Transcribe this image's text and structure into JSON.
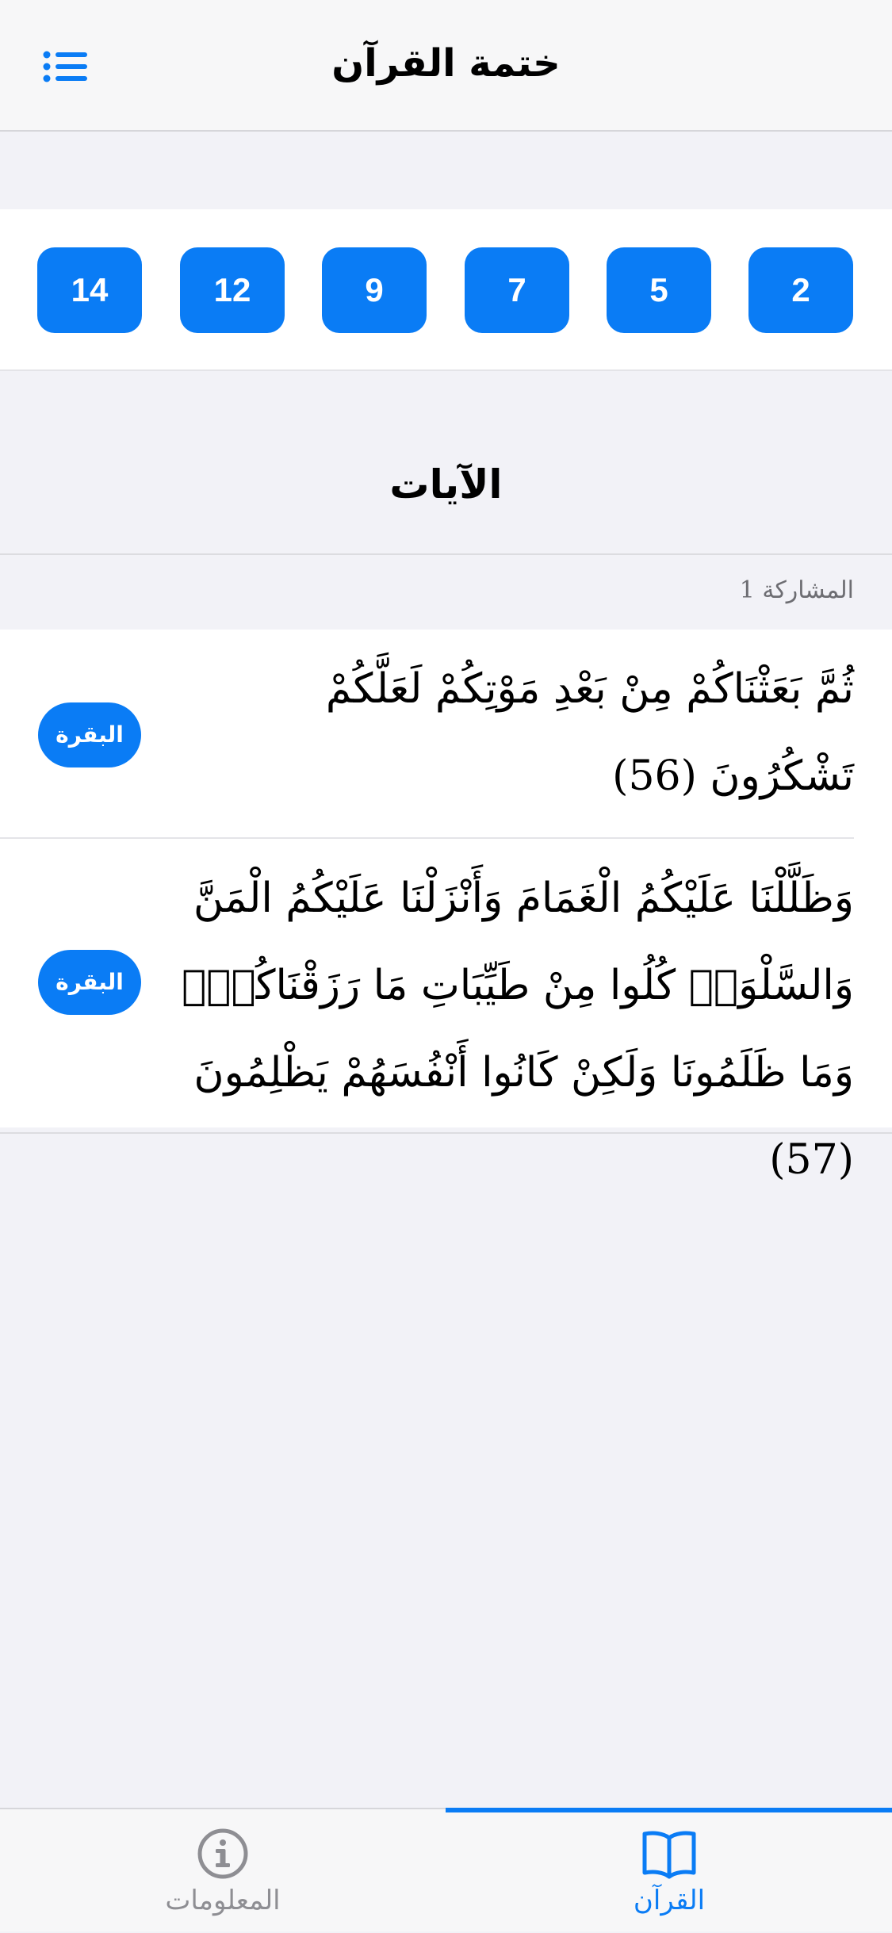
{
  "header": {
    "title": "ختمة القرآن",
    "menu_icon": "list-icon"
  },
  "parts": [
    "2",
    "5",
    "7",
    "9",
    "12",
    "14"
  ],
  "section": {
    "title": "الآيات",
    "participation": "المشاركة 1"
  },
  "verses": [
    {
      "text": "ثُمَّ بَعَثْنَاكُمْ مِنْ بَعْدِ مَوْتِكُمْ لَعَلَّكُمْ تَشْكُرُونَ (56)",
      "surah": "البقرة"
    },
    {
      "text": "وَظَلَّلْنَا عَلَيْكُمُ الْغَمَامَ وَأَنْزَلْنَا عَلَيْكُمُ الْمَنَّ وَالسَّلْوَىۖ كُلُوا مِنْ طَيِّبَاتِ مَا رَزَقْنَاكُمْۖ وَمَا ظَلَمُونَا وَلَكِنْ كَانُوا أَنْفُسَهُمْ يَظْلِمُونَ (57)",
      "surah": "البقرة"
    }
  ],
  "tabs": {
    "info": {
      "label": "المعلومات",
      "icon": "info-icon"
    },
    "quran": {
      "label": "القرآن",
      "icon": "book-icon",
      "selected": true
    }
  },
  "colors": {
    "accent": "#0a7cf5",
    "inactive": "#8e8e93",
    "background": "#f2f2f7"
  }
}
